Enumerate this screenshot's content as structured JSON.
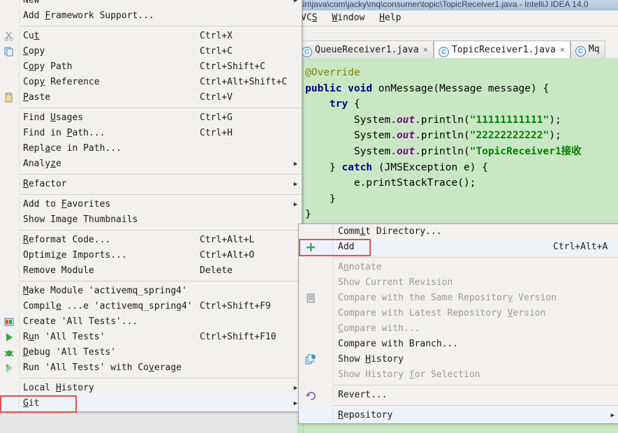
{
  "ide": {
    "title": "ain\\java\\com\\jacky\\mq\\consumer\\topic\\TopicReceiver1.java - IntelliJ IDEA 14.0",
    "menubar": [
      "VCS",
      "Window",
      "Help"
    ],
    "tabs": [
      {
        "label": "QueueReceiver1.java",
        "icon": "class-icon",
        "glyph": "C",
        "close": "×",
        "active": false
      },
      {
        "label": "TopicReceiver1.java",
        "icon": "class-icon",
        "glyph": "C",
        "close": "×",
        "active": true
      },
      {
        "label": "Mq",
        "icon": "class-icon",
        "glyph": "C",
        "close": "",
        "active": false
      }
    ],
    "code_lines": [
      {
        "tokens": [
          {
            "t": "@Override",
            "c": "ann"
          }
        ]
      },
      {
        "tokens": [
          {
            "t": "public",
            "c": "k"
          },
          {
            "t": " ",
            "c": "pl"
          },
          {
            "t": "void",
            "c": "k"
          },
          {
            "t": " onMessage(Message message) {",
            "c": "pl"
          }
        ]
      },
      {
        "tokens": [
          {
            "t": "    ",
            "c": "pl"
          },
          {
            "t": "try",
            "c": "k"
          },
          {
            "t": " {",
            "c": "pl"
          }
        ]
      },
      {
        "tokens": [
          {
            "t": "        System.",
            "c": "pl"
          },
          {
            "t": "out",
            "c": "fld"
          },
          {
            "t": ".println(",
            "c": "pl"
          },
          {
            "t": "\"11111111111\"",
            "c": "str"
          },
          {
            "t": ");",
            "c": "sc"
          }
        ]
      },
      {
        "tokens": [
          {
            "t": "        System.",
            "c": "pl"
          },
          {
            "t": "out",
            "c": "fld"
          },
          {
            "t": ".println(",
            "c": "pl"
          },
          {
            "t": "\"22222222222\"",
            "c": "str"
          },
          {
            "t": ");",
            "c": "sc"
          }
        ]
      },
      {
        "tokens": [
          {
            "t": "        System.",
            "c": "pl"
          },
          {
            "t": "out",
            "c": "fld"
          },
          {
            "t": ".println(",
            "c": "pl"
          },
          {
            "t": "\"TopicReceiver1接收",
            "c": "str"
          }
        ]
      },
      {
        "tokens": [
          {
            "t": "    } ",
            "c": "pl"
          },
          {
            "t": "catch",
            "c": "k"
          },
          {
            "t": " (JMSException e) {",
            "c": "pl"
          }
        ]
      },
      {
        "tokens": [
          {
            "t": "        e.printStackTrace();",
            "c": "pl"
          }
        ]
      },
      {
        "tokens": [
          {
            "t": "    }",
            "c": "pl"
          }
        ]
      },
      {
        "tokens": [
          {
            "t": "}",
            "c": "pl"
          }
        ]
      }
    ]
  },
  "context_menu": {
    "items": [
      {
        "label": "New",
        "mnemonic": "",
        "accel": "",
        "submenu": true,
        "icon": ""
      },
      {
        "label": "Add Framework Support...",
        "mnemonic": "F",
        "accel": "",
        "submenu": false,
        "icon": ""
      },
      {
        "separator": true
      },
      {
        "label": "Cut",
        "mnemonic": "t",
        "accel": "Ctrl+X",
        "submenu": false,
        "icon": "scissors-icon"
      },
      {
        "label": "Copy",
        "mnemonic": "C",
        "accel": "Ctrl+C",
        "submenu": false,
        "icon": "copy-icon"
      },
      {
        "label": "Copy Path",
        "mnemonic": "o",
        "accel": "Ctrl+Shift+C",
        "submenu": false,
        "icon": ""
      },
      {
        "label": "Copy Reference",
        "mnemonic": "y",
        "accel": "Ctrl+Alt+Shift+C",
        "submenu": false,
        "icon": ""
      },
      {
        "label": "Paste",
        "mnemonic": "P",
        "accel": "Ctrl+V",
        "submenu": false,
        "icon": "paste-icon"
      },
      {
        "separator": true
      },
      {
        "label": "Find Usages",
        "mnemonic": "U",
        "accel": "Ctrl+G",
        "submenu": false,
        "icon": ""
      },
      {
        "label": "Find in Path...",
        "mnemonic": "P",
        "accel": "Ctrl+H",
        "submenu": false,
        "icon": ""
      },
      {
        "label": "Replace in Path...",
        "mnemonic": "a",
        "accel": "",
        "submenu": false,
        "icon": ""
      },
      {
        "label": "Analyze",
        "mnemonic": "z",
        "accel": "",
        "submenu": true,
        "icon": ""
      },
      {
        "separator": true
      },
      {
        "label": "Refactor",
        "mnemonic": "R",
        "accel": "",
        "submenu": true,
        "icon": ""
      },
      {
        "separator": true
      },
      {
        "label": "Add to Favorites",
        "mnemonic": "F",
        "accel": "",
        "submenu": true,
        "icon": ""
      },
      {
        "label": "Show Image Thumbnails",
        "mnemonic": "",
        "accel": "",
        "submenu": false,
        "icon": ""
      },
      {
        "separator": true
      },
      {
        "label": "Reformat Code...",
        "mnemonic": "R",
        "accel": "Ctrl+Alt+L",
        "submenu": false,
        "icon": ""
      },
      {
        "label": "Optimize Imports...",
        "mnemonic": "z",
        "accel": "Ctrl+Alt+O",
        "submenu": false,
        "icon": ""
      },
      {
        "label": "Remove Module",
        "mnemonic": "",
        "accel": "Delete",
        "submenu": false,
        "icon": ""
      },
      {
        "separator": true
      },
      {
        "label": "Make Module 'activemq_spring4'",
        "mnemonic": "M",
        "accel": "",
        "submenu": false,
        "icon": ""
      },
      {
        "label": "Compile ...e 'activemq_spring4'",
        "mnemonic": "e",
        "accel": "Ctrl+Shift+F9",
        "submenu": false,
        "icon": ""
      },
      {
        "label": "Create 'All Tests'...",
        "mnemonic": "",
        "accel": "",
        "submenu": false,
        "icon": "test-icon"
      },
      {
        "label": "Run 'All Tests'",
        "mnemonic": "u",
        "accel": "Ctrl+Shift+F10",
        "submenu": false,
        "icon": "run-icon"
      },
      {
        "label": "Debug 'All Tests'",
        "mnemonic": "D",
        "accel": "",
        "submenu": false,
        "icon": "debug-icon"
      },
      {
        "label": "Run 'All Tests' with Coverage",
        "mnemonic": "v",
        "accel": "",
        "submenu": false,
        "icon": "coverage-icon"
      },
      {
        "separator": true
      },
      {
        "label": "Local History",
        "mnemonic": "H",
        "accel": "",
        "submenu": true,
        "icon": ""
      },
      {
        "label": "Git",
        "mnemonic": "G",
        "accel": "",
        "submenu": true,
        "icon": "",
        "highlighted": true,
        "selected": true
      }
    ]
  },
  "git_submenu": {
    "items": [
      {
        "label": "Commit Directory...",
        "mnemonic": "i",
        "accel": "",
        "icon": "",
        "disabled": false
      },
      {
        "label": "Add",
        "mnemonic": "",
        "accel": "Ctrl+Alt+A",
        "icon": "plus-icon",
        "disabled": false,
        "highlighted": true
      },
      {
        "separator": true
      },
      {
        "label": "Annotate",
        "mnemonic": "n",
        "accel": "",
        "icon": "",
        "disabled": true
      },
      {
        "label": "Show Current Revision",
        "mnemonic": "",
        "accel": "",
        "icon": "",
        "disabled": true
      },
      {
        "label": "Compare with the Same Repository Version",
        "mnemonic": "y",
        "accel": "",
        "icon": "repository-icon",
        "disabled": true
      },
      {
        "label": "Compare with Latest Repository Version",
        "mnemonic": "V",
        "accel": "",
        "icon": "",
        "disabled": true
      },
      {
        "label": "Compare with...",
        "mnemonic": "C",
        "accel": "",
        "icon": "",
        "disabled": true
      },
      {
        "label": "Compare with Branch...",
        "mnemonic": "",
        "accel": "",
        "icon": "",
        "disabled": false
      },
      {
        "label": "Show History",
        "mnemonic": "H",
        "accel": "",
        "icon": "history-icon",
        "disabled": false
      },
      {
        "label": "Show History for Selection",
        "mnemonic": "f",
        "accel": "",
        "icon": "",
        "disabled": true
      },
      {
        "separator": true
      },
      {
        "label": "Revert...",
        "mnemonic": "",
        "accel": "",
        "icon": "revert-icon",
        "disabled": false
      },
      {
        "separator": true
      },
      {
        "label": "Repository",
        "mnemonic": "R",
        "accel": "",
        "icon": "",
        "disabled": false,
        "submenu": true,
        "selected": true
      }
    ]
  },
  "colors": {
    "highlight_border": "#e0534a",
    "editor_bg": "#c9e7c4",
    "menu_bg": "#f2f1f0",
    "selection_bg": "#eef3fb",
    "string_green": "#008000",
    "keyword_blue": "#000080"
  }
}
